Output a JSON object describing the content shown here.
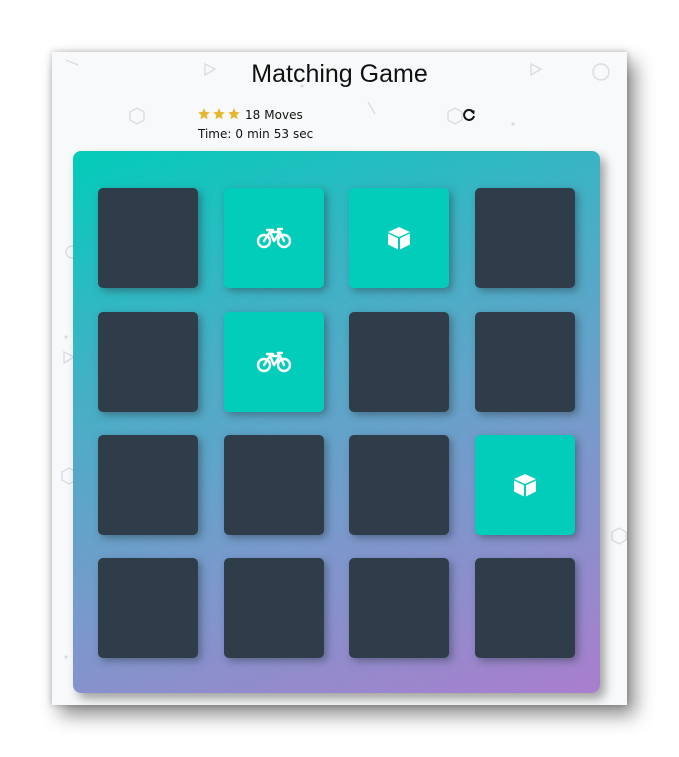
{
  "game": {
    "title": "Matching Game",
    "rating_stars": 3,
    "moves_count": "18",
    "moves_label": "Moves",
    "timer_label": "Time:",
    "timer_minutes": "0",
    "timer_min_unit": "min",
    "timer_seconds": "53",
    "timer_sec_unit": "sec",
    "restart_icon": "restart-icon"
  },
  "deck": {
    "rows": 4,
    "cols": 4,
    "cards": [
      {
        "state": "closed",
        "icon": ""
      },
      {
        "state": "open",
        "icon": "bicycle"
      },
      {
        "state": "open",
        "icon": "cube"
      },
      {
        "state": "closed",
        "icon": ""
      },
      {
        "state": "closed",
        "icon": ""
      },
      {
        "state": "open",
        "icon": "bicycle"
      },
      {
        "state": "closed",
        "icon": ""
      },
      {
        "state": "closed",
        "icon": ""
      },
      {
        "state": "closed",
        "icon": ""
      },
      {
        "state": "closed",
        "icon": ""
      },
      {
        "state": "closed",
        "icon": ""
      },
      {
        "state": "open",
        "icon": "cube"
      },
      {
        "state": "closed",
        "icon": ""
      },
      {
        "state": "closed",
        "icon": ""
      },
      {
        "state": "closed",
        "icon": ""
      },
      {
        "state": "closed",
        "icon": ""
      }
    ]
  },
  "colors": {
    "card_closed": "#2e3d49",
    "card_open": "#02ccba",
    "star": "#e6b62d",
    "deck_gradient_start": "#02ccba",
    "deck_gradient_end": "#aa7ecd"
  }
}
